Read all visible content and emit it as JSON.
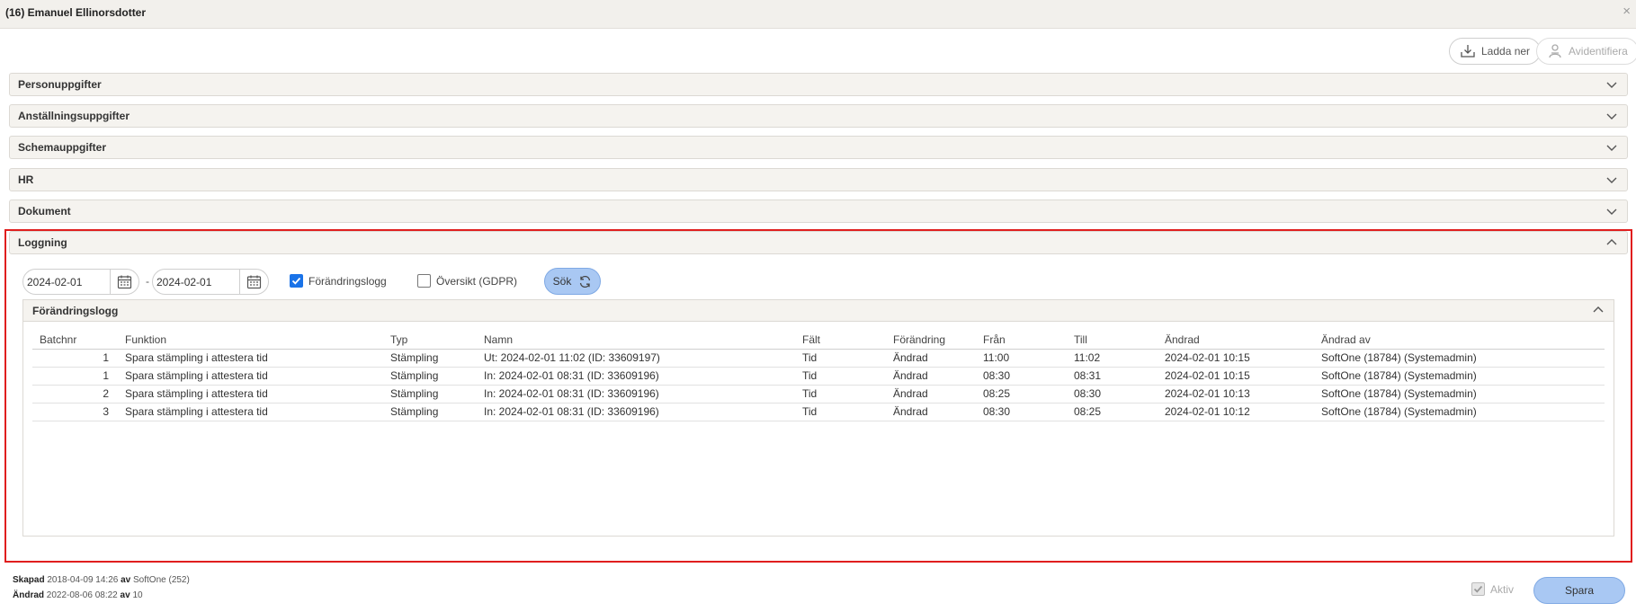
{
  "window": {
    "title": "(16) Emanuel Ellinorsdotter",
    "close_glyph": "×"
  },
  "toolbar": {
    "download_label": "Ladda ner",
    "deidentify_label": "Avidentifiera"
  },
  "sections": [
    {
      "label": "Personuppgifter"
    },
    {
      "label": "Anställningsuppgifter"
    },
    {
      "label": "Schemauppgifter"
    },
    {
      "label": "HR"
    },
    {
      "label": "Dokument"
    }
  ],
  "logging": {
    "label": "Loggning",
    "date_from": "2024-02-01",
    "date_separator": "-",
    "date_to": "2024-02-01",
    "change_log_checkbox": {
      "label": "Förändringslogg",
      "checked": true
    },
    "gdpr_checkbox": {
      "label": "Översikt (GDPR)",
      "checked": false
    },
    "search_label": "Sök",
    "change_log": {
      "label": "Förändringslogg",
      "columns": [
        "Batchnr",
        "Funktion",
        "Typ",
        "Namn",
        "Fält",
        "Förändring",
        "Från",
        "Till",
        "Ändrad",
        "Ändrad av"
      ],
      "rows": [
        [
          "1",
          "Spara stämpling i attestera tid",
          "Stämpling",
          "Ut: 2024-02-01 11:02 (ID: 33609197)",
          "Tid",
          "Ändrad",
          "11:00",
          "11:02",
          "2024-02-01 10:15",
          "SoftOne (18784) (Systemadmin)"
        ],
        [
          "1",
          "Spara stämpling i attestera tid",
          "Stämpling",
          "In: 2024-02-01 08:31 (ID: 33609196)",
          "Tid",
          "Ändrad",
          "08:30",
          "08:31",
          "2024-02-01 10:15",
          "SoftOne (18784) (Systemadmin)"
        ],
        [
          "2",
          "Spara stämpling i attestera tid",
          "Stämpling",
          "In: 2024-02-01 08:31 (ID: 33609196)",
          "Tid",
          "Ändrad",
          "08:25",
          "08:30",
          "2024-02-01 10:13",
          "SoftOne (18784) (Systemadmin)"
        ],
        [
          "3",
          "Spara stämpling i attestera tid",
          "Stämpling",
          "In: 2024-02-01 08:31 (ID: 33609196)",
          "Tid",
          "Ändrad",
          "08:30",
          "08:25",
          "2024-02-01 10:12",
          "SoftOne (18784) (Systemadmin)"
        ]
      ]
    }
  },
  "footer": {
    "created_label": "Skapad",
    "created_date": "2018-04-09 14:26",
    "by_label": "av",
    "created_by": "SoftOne (252)",
    "changed_label": "Ändrad",
    "changed_date": "2022-08-06 08:22",
    "changed_by": "10",
    "active_label": "Aktiv",
    "save_label": "Spara"
  },
  "colors": {
    "accent_button": "#a9c8f3",
    "highlight_border": "#e01e1e",
    "checkbox_checked": "#1a73e8"
  }
}
